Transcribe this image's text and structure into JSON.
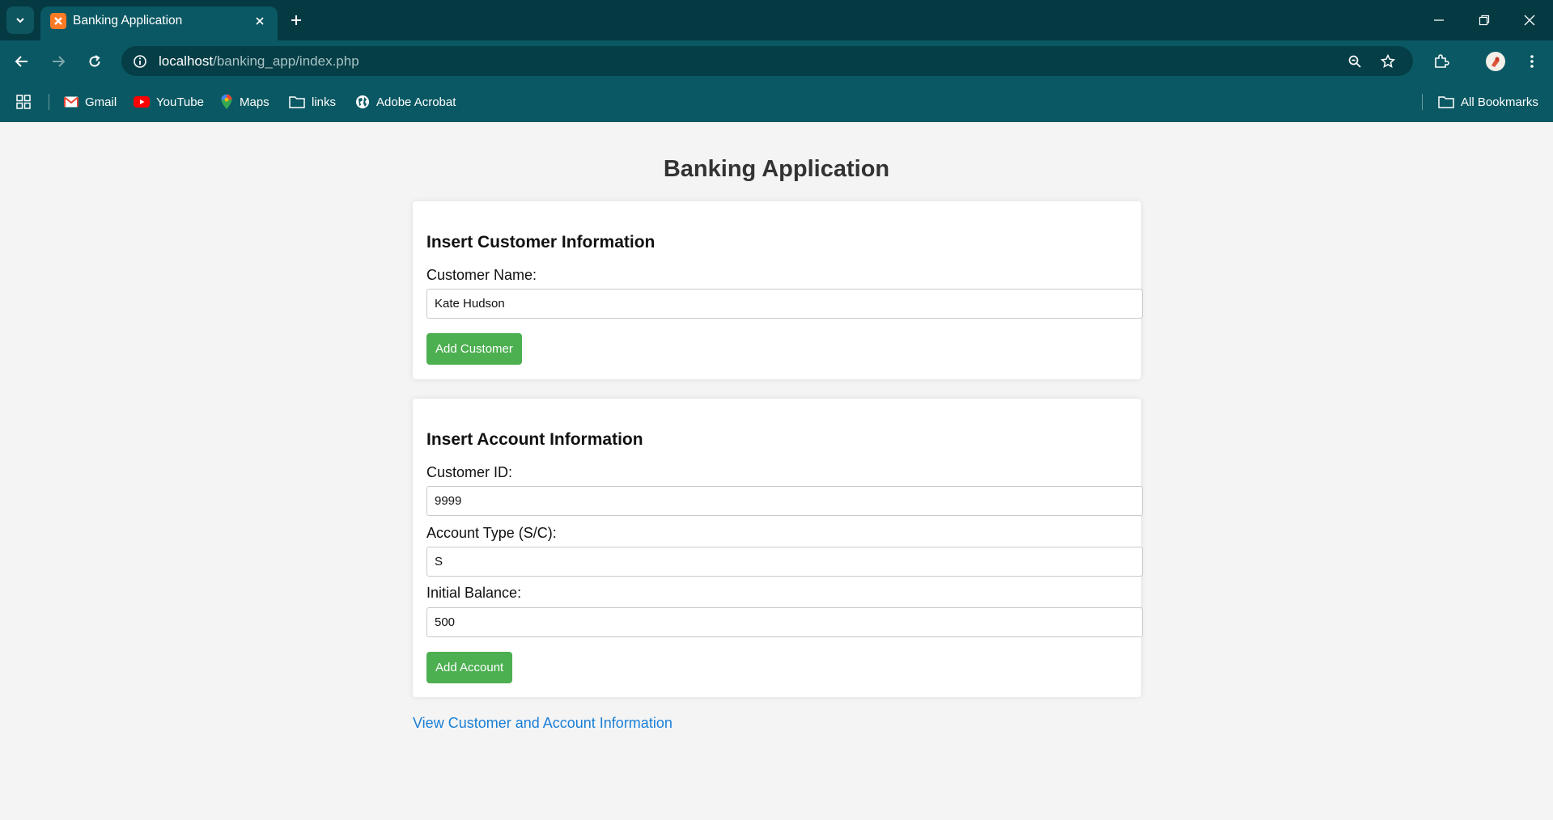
{
  "browser": {
    "tab_title": "Banking Application",
    "url_host": "localhost",
    "url_path": "/banking_app/index.php",
    "bookmarks": [
      {
        "label": "Gmail",
        "icon": "gmail-icon"
      },
      {
        "label": "YouTube",
        "icon": "youtube-icon"
      },
      {
        "label": "Maps",
        "icon": "maps-icon"
      },
      {
        "label": "links",
        "icon": "folder-icon"
      },
      {
        "label": "Adobe Acrobat",
        "icon": "globe-icon"
      }
    ],
    "all_bookmarks": "All Bookmarks"
  },
  "page": {
    "title": "Banking Application",
    "customer_section": {
      "heading": "Insert Customer Information",
      "name_label": "Customer Name:",
      "name_value": "Kate Hudson",
      "button": "Add Customer"
    },
    "account_section": {
      "heading": "Insert Account Information",
      "customer_id_label": "Customer ID:",
      "customer_id_value": "9999",
      "account_type_label": "Account Type (S/C):",
      "account_type_value": "S",
      "balance_label": "Initial Balance:",
      "balance_value": "500",
      "button": "Add Account"
    },
    "view_link": "View Customer and Account Information"
  },
  "colors": {
    "chrome_dark": "#053a42",
    "chrome": "#0a5863",
    "button_green": "#4caf50",
    "link_blue": "#1a7fd6",
    "page_bg": "#f4f4f4"
  }
}
